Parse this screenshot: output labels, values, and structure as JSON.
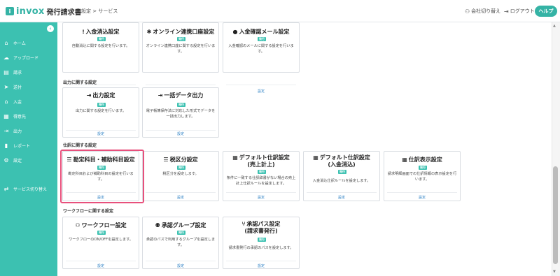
{
  "header": {
    "logo_text": "invox",
    "logo_sub": "発行請求書",
    "breadcrumb": "設定 > サービス",
    "switch_company": "会社切り替え",
    "logout": "ログアウト",
    "help": "ヘルプ"
  },
  "sidebar": {
    "items": [
      {
        "label": "ホーム",
        "icon": "home-icon",
        "glyph": "⌂"
      },
      {
        "label": "アップロード",
        "icon": "cloud-upload-icon",
        "glyph": "☁"
      },
      {
        "label": "請求",
        "icon": "document-icon",
        "glyph": "▤"
      },
      {
        "label": "送付",
        "icon": "send-icon",
        "glyph": "➤"
      },
      {
        "label": "入金",
        "icon": "bank-icon",
        "glyph": "⌂"
      },
      {
        "label": "得意先",
        "icon": "building-icon",
        "glyph": "▦"
      },
      {
        "label": "出力",
        "icon": "export-icon",
        "glyph": "⇥"
      },
      {
        "label": "レポート",
        "icon": "chart-icon",
        "glyph": "▮"
      },
      {
        "label": "設定",
        "icon": "gear-icon",
        "glyph": "⚙"
      }
    ],
    "service_switch": {
      "label": "サービス切り替え",
      "icon": "switch-icon",
      "glyph": "⇄"
    }
  },
  "badge_label": "発行",
  "link_label": "設定",
  "sections": {
    "output": "出力に関する設定",
    "journal": "仕訳に関する設定",
    "workflow": "ワークフローに関する設定"
  },
  "cards": {
    "auto_clear": {
      "title": "入金消込設定",
      "desc": "自動消込に関する設定を行います。",
      "icon": "list-check-icon",
      "glyph": "⁝"
    },
    "online": {
      "title": "オンライン連携口座設定",
      "desc": "オンライン連携口座に関する設定を行います。",
      "icon": "key-icon",
      "glyph": "✱"
    },
    "confirm_mail": {
      "title": "入金確認メール設定",
      "desc": "入金確認のメールに関する設定を行います。",
      "icon": "mail-icon",
      "glyph": "●"
    },
    "output": {
      "title": "出力設定",
      "desc": "出力に関する設定を行います。",
      "icon": "export-icon",
      "glyph": "⇥"
    },
    "bulk_output": {
      "title": "一括データ出力",
      "desc": "電子帳簿保存法に対応した形式でデータを一括出力します。",
      "icon": "export-icon",
      "glyph": "⇥"
    },
    "account_item": {
      "title": "勘定科目・補助科目設定",
      "desc": "勘定科目および補助科目の設定を行います。",
      "icon": "list-icon",
      "glyph": "☰"
    },
    "tax_class": {
      "title": "税区分設定",
      "desc": "税区分を設定します。",
      "icon": "list-icon",
      "glyph": "☰"
    },
    "default_journal_sales": {
      "title": "デフォルト仕訳設定",
      "title2": "(売上計上)",
      "desc": "条件に一致する仕訳辞書がない場合の売上計上仕訳ルールを設定します。",
      "icon": "table-icon",
      "glyph": "▦"
    },
    "default_journal_clear": {
      "title": "デフォルト仕訳設定",
      "title2": "(入金消込)",
      "desc": "入金消込仕訳ルールを設定します。",
      "icon": "table-icon",
      "glyph": "▦"
    },
    "journal_display": {
      "title": "仕訳表示設定",
      "desc": "請求明細画面での仕訳情報の表示設定を行います。",
      "icon": "table-icon",
      "glyph": "▦"
    },
    "workflow": {
      "title": "ワークフロー設定",
      "desc": "ワークフローのON/OFFを設定します。",
      "icon": "workflow-icon",
      "glyph": "⚇"
    },
    "approval_group": {
      "title": "承認グループ設定",
      "desc": "承認のパスで利用するグループを設定します。",
      "icon": "users-icon",
      "glyph": "⚉"
    },
    "approval_path": {
      "title": "承認パス設定",
      "title2": "(請求書発行)",
      "desc": "請求書発行の承認のパスを設定します。",
      "icon": "branch-icon",
      "glyph": "⑂"
    }
  },
  "colors": {
    "brand": "#3cc1b1",
    "highlight": "#e8507c",
    "link": "#2a7fc4"
  }
}
